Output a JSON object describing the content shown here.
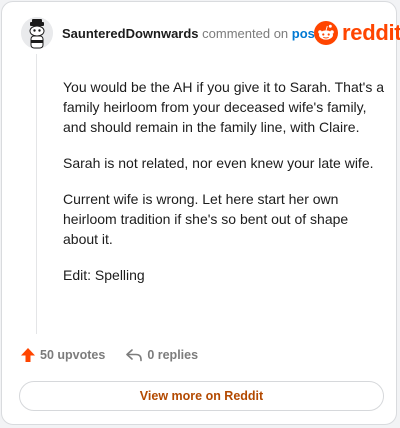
{
  "comment": {
    "username": "SaunteredDownwards",
    "commented_text": "commented on",
    "post_link": "post",
    "paragraphs": [
      "You would be the AH if you give it to Sarah. That's a family heirloom from your deceased wife's family, and should remain in the family line, with Claire.",
      "Sarah is not related, nor even knew your late wife.",
      "Current wife is wrong. Let here start her own heirloom tradition if she's so bent out of shape about it.",
      "Edit: Spelling"
    ],
    "upvotes": "50 upvotes",
    "replies": "0 replies"
  },
  "brand": {
    "wordmark": "reddit",
    "color": "#ff4500"
  },
  "footer": {
    "view_button": "View more on Reddit"
  },
  "icons": {
    "avatar": "snoo-avatar-icon",
    "logo": "reddit-logo-icon",
    "upvote": "upvote-arrow-icon",
    "reply": "reply-arrow-icon"
  }
}
